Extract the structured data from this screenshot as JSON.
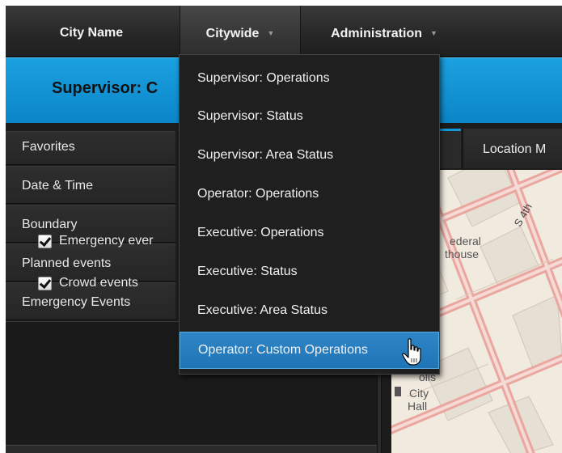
{
  "nav": {
    "city_name": "City Name",
    "citywide": "Citywide",
    "administration": "Administration"
  },
  "banner": {
    "title": "Supervisor: C"
  },
  "sidebar": {
    "items": [
      {
        "label": "Favorites"
      },
      {
        "label": "Date & Time"
      },
      {
        "label": "Boundary"
      },
      {
        "label": "Planned events"
      },
      {
        "label": "Emergency Events"
      }
    ],
    "checkboxes": [
      {
        "label": "Emergency ever",
        "checked": true
      },
      {
        "label": "Crowd events",
        "checked": true
      }
    ]
  },
  "tabs": {
    "location": "Location M"
  },
  "map": {
    "labels": [
      "ederal",
      "thouse",
      "olis",
      "City",
      "Hall",
      "S 4th"
    ]
  },
  "dropdown": {
    "items": [
      "Supervisor: Operations",
      "Supervisor: Status",
      "Supervisor: Area Status",
      "Operator: Operations",
      "Executive: Operations",
      "Executive: Status",
      "Executive: Area Status",
      "Operator: Custom Operations"
    ],
    "selected_index": 7
  },
  "colors": {
    "accent_blue": "#1499d8",
    "selected_item": "#2f86c6",
    "nav_bg": "#2a2a2a"
  },
  "icons": {
    "cursor": "hand-pointer-icon",
    "caret": "chevron-down-icon"
  }
}
